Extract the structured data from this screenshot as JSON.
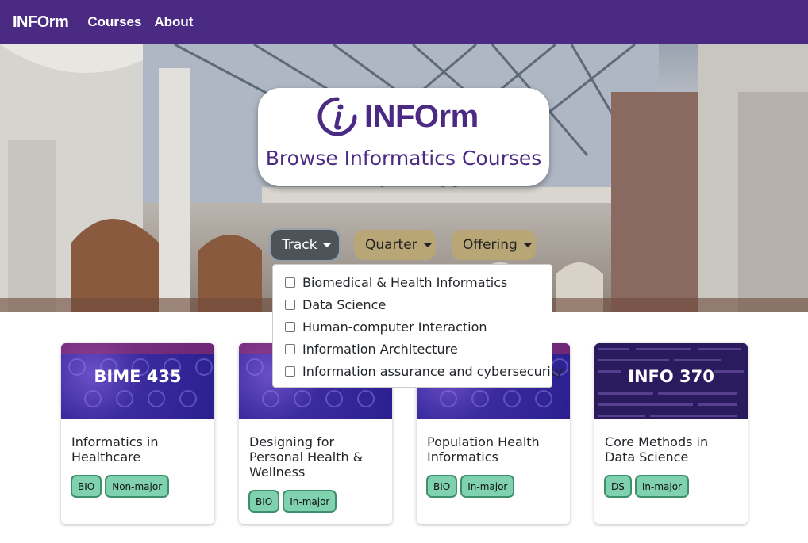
{
  "nav": {
    "brand": "INFOrm",
    "links": [
      "Courses",
      "About"
    ]
  },
  "hero": {
    "logo_word": "INFOrm",
    "subtitle": "Browse Informatics Courses",
    "filters": [
      {
        "label": "Track",
        "state": "open"
      },
      {
        "label": "Quarter",
        "state": "closed"
      },
      {
        "label": "Offering",
        "state": "closed"
      }
    ]
  },
  "track_dropdown": {
    "options": [
      {
        "label": "Biomedical & Health Informatics",
        "checked": false
      },
      {
        "label": "Data Science",
        "checked": false
      },
      {
        "label": "Human-computer Interaction",
        "checked": false
      },
      {
        "label": "Information Architecture",
        "checked": false
      },
      {
        "label": "Information assurance and cybersecurity",
        "checked": false
      }
    ]
  },
  "courses": [
    {
      "code": "BIME 435",
      "title": "Informatics in Healthcare",
      "tags": [
        "BIO",
        "Non-major"
      ],
      "image": "bio"
    },
    {
      "code": "",
      "title": "Designing for Personal Health & Wellness",
      "tags": [
        "BIO",
        "In-major"
      ],
      "image": "bio"
    },
    {
      "code": "",
      "title": "Population Health Informatics",
      "tags": [
        "BIO",
        "In-major"
      ],
      "image": "bio"
    },
    {
      "code": "INFO 370",
      "title": "Core Methods in Data Science",
      "tags": [
        "DS",
        "In-major"
      ],
      "image": "ds"
    }
  ],
  "colors": {
    "brand_purple": "#4b2a83",
    "gold": "#b9a677",
    "tag_green": "#7fd1b0"
  }
}
